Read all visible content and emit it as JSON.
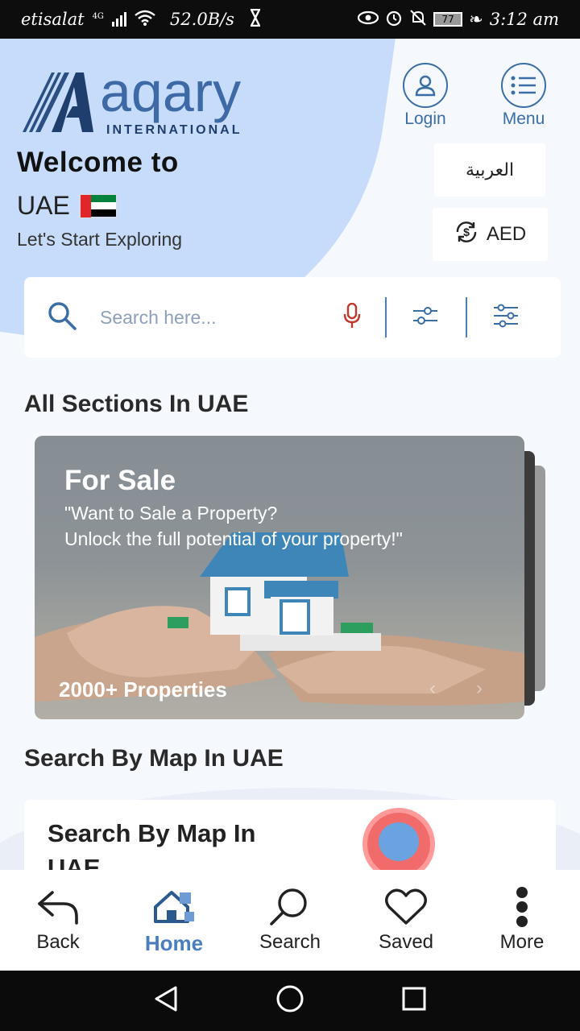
{
  "status_bar": {
    "carrier": "etisalat",
    "network": "4G",
    "speed": "52.0B/s",
    "battery": "77",
    "time": "3:12 am"
  },
  "header": {
    "logo_main": "aqary",
    "logo_sub": "INTERNATIONAL",
    "login_label": "Login",
    "menu_label": "Menu",
    "language_label": "العربية",
    "currency_label": "AED"
  },
  "welcome": {
    "line1": "Welcome to",
    "country": "UAE",
    "subtitle": "Let's Start Exploring"
  },
  "search": {
    "placeholder": "Search here..."
  },
  "sections": {
    "title": "All Sections In UAE",
    "card": {
      "title": "For Sale",
      "description_line1": "\"Want to Sale a Property?",
      "description_line2": "Unlock the full potential of your property!\"",
      "count": "2000+ Properties",
      "prev": "‹",
      "next": "›"
    }
  },
  "map_section": {
    "title": "Search By Map In UAE",
    "card_title": "Search By Map In UAE"
  },
  "bottom_nav": {
    "items": [
      {
        "label": "Back",
        "icon": "back-arrow-icon"
      },
      {
        "label": "Home",
        "icon": "home-icon"
      },
      {
        "label": "Search",
        "icon": "search-icon"
      },
      {
        "label": "Saved",
        "icon": "heart-icon"
      },
      {
        "label": "More",
        "icon": "more-vertical-icon"
      }
    ]
  },
  "colors": {
    "accent": "#3a6ea6",
    "active_nav": "#4a7fbf",
    "hero_blob": "#c7dcfb",
    "mic": "#c0392b"
  }
}
